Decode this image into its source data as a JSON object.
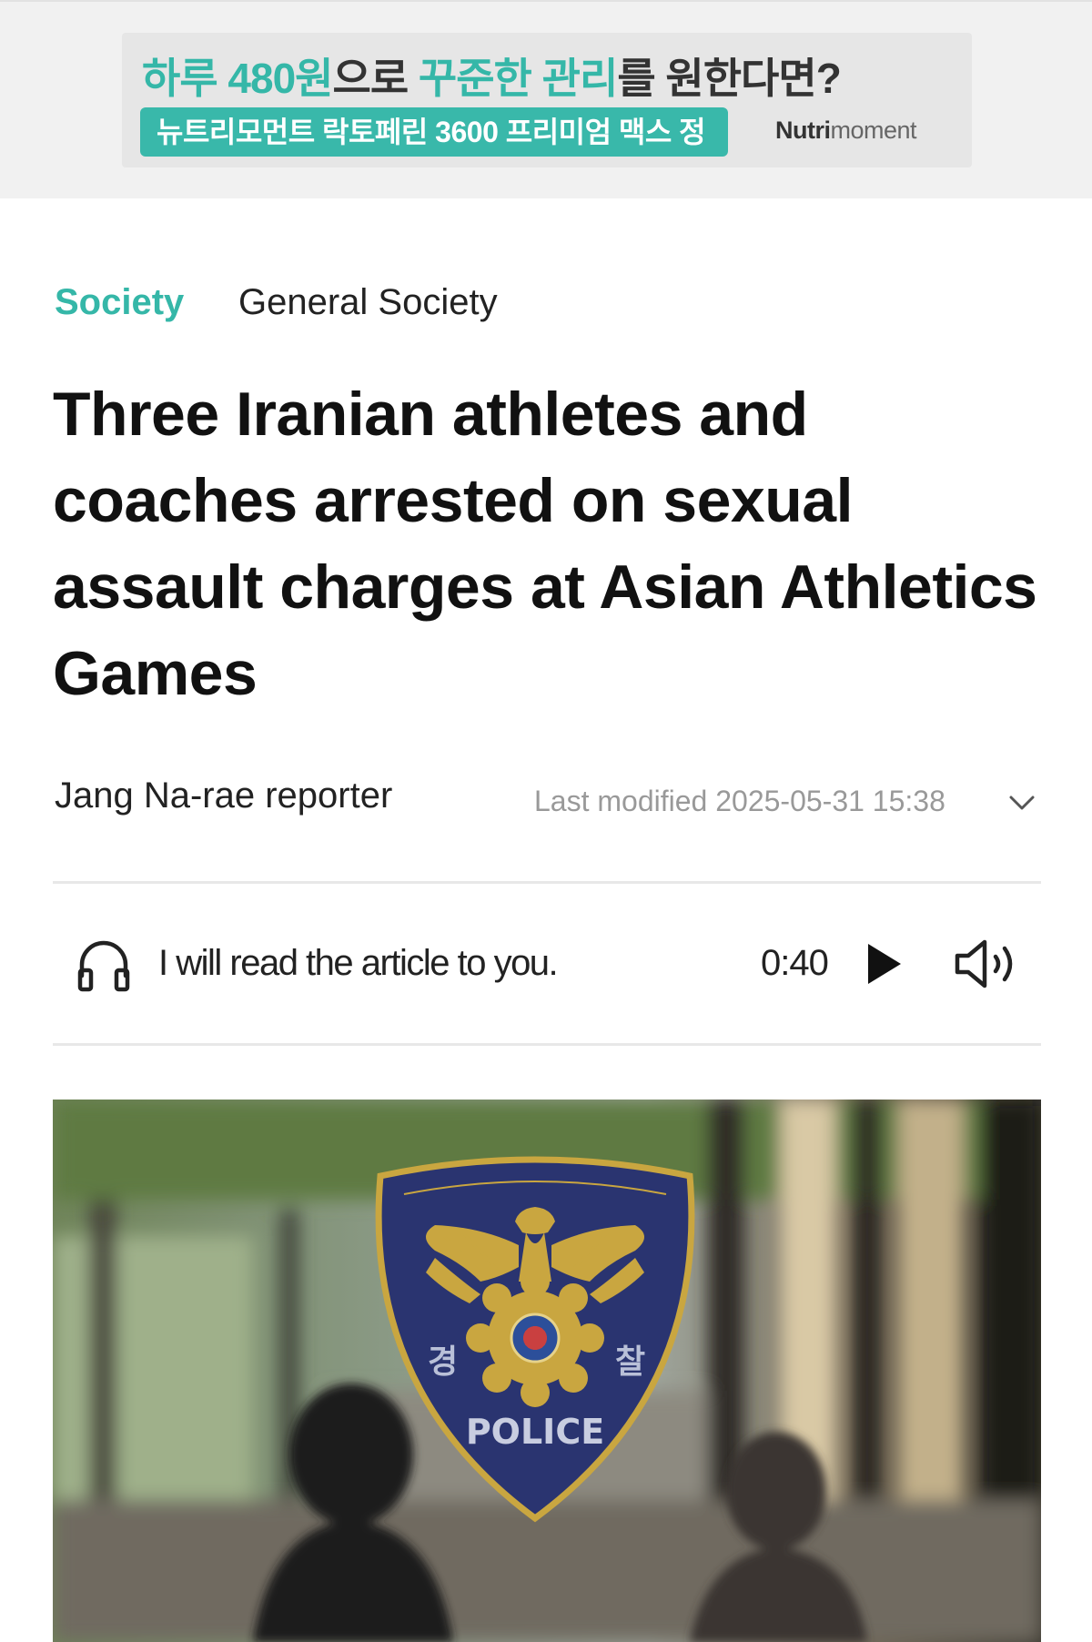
{
  "ad": {
    "headline_accent1": "하루 480원",
    "headline_plain1": "으로 ",
    "headline_accent2": "꾸준한 관리",
    "headline_plain2": "를 원한다면?",
    "cta": "뉴트리모먼트 락토페린 3600 프리미엄 맥스 정",
    "brand_bold": "Nutri",
    "brand_rest": "moment"
  },
  "article": {
    "category": "Society",
    "subcategory": "General Society",
    "headline": "Three Iranian athletes and coaches arrested on sexual assault charges at Asian Athletics Games",
    "reporter": "Jang Na-rae reporter",
    "last_modified": "Last modified 2025-05-31 15:38"
  },
  "audio": {
    "label": "I will read the article to you.",
    "duration": "0:40",
    "headphones_icon": "headphones-icon",
    "play_icon": "play-icon",
    "volume_icon": "volume-icon"
  },
  "photo": {
    "emblem_left_char": "경",
    "emblem_right_char": "찰",
    "emblem_text": "POLICE"
  },
  "colors": {
    "accent": "#35b7a8",
    "emblem_navy": "#2a3470",
    "emblem_gold": "#c9a640"
  }
}
